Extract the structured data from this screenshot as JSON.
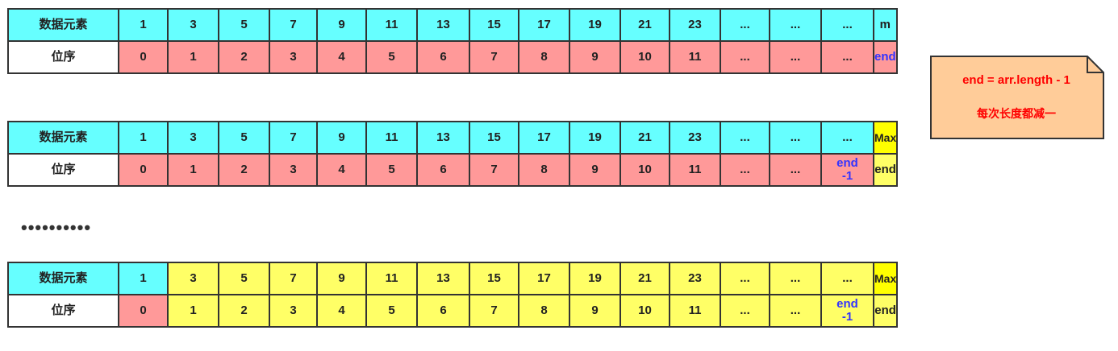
{
  "labels": {
    "data": "数据元素",
    "index": "位序"
  },
  "values": [
    "1",
    "3",
    "5",
    "7",
    "9",
    "11",
    "13",
    "15",
    "17",
    "19",
    "21",
    "23",
    "...",
    "...",
    "..."
  ],
  "indices": [
    "0",
    "1",
    "2",
    "3",
    "4",
    "5",
    "6",
    "7",
    "8",
    "9",
    "10",
    "11",
    "...",
    "...",
    "..."
  ],
  "table1": {
    "last_value": "m",
    "last_index": "end"
  },
  "table2": {
    "end_minus_label": "end\n-1",
    "last_value": "Max",
    "last_index": "end"
  },
  "table3": {
    "end_minus_label": "end\n-1",
    "last_value": "Max",
    "last_index": "end"
  },
  "ellipsis": "••••••••••",
  "note": {
    "line1": "end = arr.length - 1",
    "line2": "每次长度都减一"
  },
  "colors": {
    "cyan": "#66ffff",
    "pink": "#ff9999",
    "yellow": "#ffff66",
    "max_yellow": "#ffff00",
    "end_blue": "#3333ff",
    "note_bg": "#ffcc99",
    "note_text": "#ff0000"
  }
}
